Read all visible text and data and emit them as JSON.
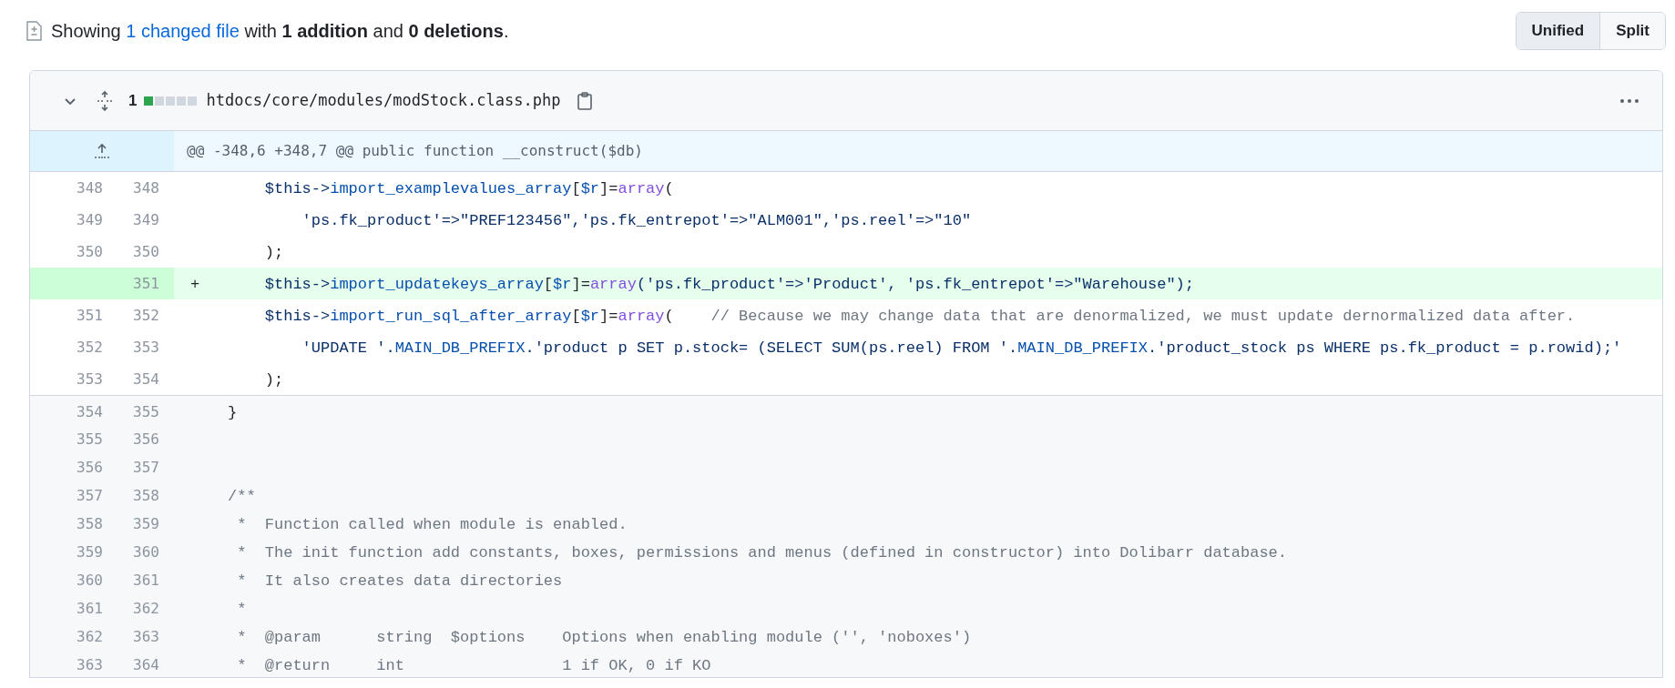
{
  "summary": {
    "prefix": "Showing",
    "link": "1 changed file",
    "suffix": "with **1 addition** and **0 deletions**."
  },
  "view_toggle": [
    {
      "label": "Unified",
      "selected": true
    },
    {
      "label": "Split",
      "selected": false
    }
  ],
  "file": {
    "expanded": true,
    "change_count": "1",
    "diffstat": [
      {
        "kind": "added"
      },
      {
        "kind": "neutral"
      },
      {
        "kind": "neutral"
      },
      {
        "kind": "neutral"
      },
      {
        "kind": "neutral"
      }
    ],
    "path": "htdocs/core/modules/modStock.class.php"
  },
  "hunk": {
    "header": "@@ -348,6 +348,7 @@ public function __construct($db)"
  },
  "rows": [
    {
      "kind": "context",
      "old": "348",
      "new": "348",
      "tokens": [
        {
          "kind": "var",
          "text": "    $this->"
        },
        {
          "kind": "fn",
          "text": "import_examplevalues_array"
        },
        {
          "kind": "plain",
          "text": "["
        },
        {
          "kind": "fn",
          "text": "$r"
        },
        {
          "kind": "plain",
          "text": "]="
        },
        {
          "kind": "kw",
          "text": "array"
        },
        {
          "kind": "plain",
          "text": "("
        }
      ]
    },
    {
      "kind": "context",
      "old": "349",
      "new": "349",
      "tokens": [
        {
          "kind": "str",
          "text": "        'ps.fk_product'=>\"PREF123456\",'ps.fk_entrepot'=>\"ALM001\",'ps.reel'=>\"10\""
        }
      ]
    },
    {
      "kind": "context",
      "old": "350",
      "new": "350",
      "tokens": [
        {
          "kind": "plain",
          "text": "    );"
        }
      ]
    },
    {
      "kind": "addition",
      "marker": "+",
      "new": "351",
      "tokens": [
        {
          "kind": "var",
          "text": "    $this->"
        },
        {
          "kind": "fn",
          "text": "import_updatekeys_array"
        },
        {
          "kind": "plain",
          "text": "["
        },
        {
          "kind": "fn",
          "text": "$r"
        },
        {
          "kind": "plain",
          "text": "]="
        },
        {
          "kind": "kw",
          "text": "array"
        },
        {
          "kind": "str",
          "text": "('ps.fk_product'=>'Product', 'ps.fk_entrepot'=>\"Warehouse\");"
        }
      ]
    },
    {
      "kind": "context",
      "old": "351",
      "new": "352",
      "tokens": [
        {
          "kind": "var",
          "text": "    $this->"
        },
        {
          "kind": "fn",
          "text": "import_run_sql_after_array"
        },
        {
          "kind": "plain",
          "text": "["
        },
        {
          "kind": "fn",
          "text": "$r"
        },
        {
          "kind": "plain",
          "text": "]="
        },
        {
          "kind": "kw",
          "text": "array"
        },
        {
          "kind": "plain",
          "text": "("
        },
        {
          "kind": "comment",
          "text": "    // Because we may change data that are denormalized, we must update dernormalized data after."
        }
      ]
    },
    {
      "kind": "context",
      "old": "352",
      "new": "353",
      "tokens": [
        {
          "kind": "str",
          "text": "        'UPDATE '."
        },
        {
          "kind": "fn",
          "text": "MAIN_DB_PREFIX"
        },
        {
          "kind": "str",
          "text": ".'product p SET p.stock= (SELECT SUM(ps.reel) FROM '."
        },
        {
          "kind": "fn",
          "text": "MAIN_DB_PREFIX"
        },
        {
          "kind": "str",
          "text": ".'product_stock ps WHERE ps.fk_product = p.rowid);'"
        }
      ]
    },
    {
      "kind": "context",
      "old": "353",
      "new": "354",
      "tokens": [
        {
          "kind": "plain",
          "text": "    );"
        }
      ]
    },
    {
      "kind": "expanded",
      "old": "354",
      "new": "355",
      "tokens": [
        {
          "kind": "plain",
          "text": "}"
        }
      ]
    },
    {
      "kind": "expanded",
      "old": "355",
      "new": "356"
    },
    {
      "kind": "expanded",
      "old": "356",
      "new": "357"
    },
    {
      "kind": "expanded",
      "old": "357",
      "new": "358",
      "tokens": [
        {
          "kind": "comment",
          "text": "/**"
        }
      ]
    },
    {
      "kind": "expanded",
      "old": "358",
      "new": "359",
      "tokens": [
        {
          "kind": "comment",
          "text": " *  Function called when module is enabled."
        }
      ]
    },
    {
      "kind": "expanded",
      "old": "359",
      "new": "360",
      "tokens": [
        {
          "kind": "comment",
          "text": " *  The init function add constants, boxes, permissions and menus (defined in constructor) into Dolibarr database."
        }
      ]
    },
    {
      "kind": "expanded",
      "old": "360",
      "new": "361",
      "tokens": [
        {
          "kind": "comment",
          "text": " *  It also creates data directories"
        }
      ]
    },
    {
      "kind": "expanded",
      "old": "361",
      "new": "362",
      "tokens": [
        {
          "kind": "comment",
          "text": " *"
        }
      ]
    },
    {
      "kind": "expanded",
      "old": "362",
      "new": "363",
      "tokens": [
        {
          "kind": "comment",
          "text": " *  @param      string  $options    Options when enabling module ('', 'noboxes')"
        }
      ]
    },
    {
      "kind": "expanded",
      "old": "363",
      "new": "364",
      "tokens": [
        {
          "kind": "comment",
          "text": " *  @return     int                 1 if OK, 0 if KO"
        }
      ]
    }
  ]
}
